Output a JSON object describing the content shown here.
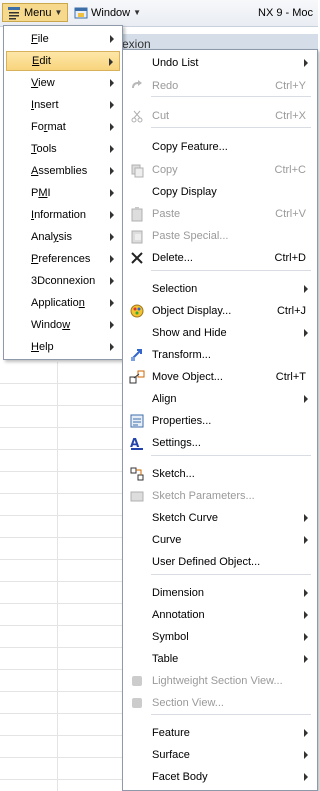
{
  "toolbar": {
    "menu_label": "Menu",
    "window_label": "Window",
    "app_title": "NX 9 - Moc"
  },
  "workspace": {
    "header_text": "exion"
  },
  "main_menu": {
    "items": [
      {
        "label": "File",
        "key": "F",
        "rest": "ile"
      },
      {
        "label": "Edit",
        "key": "E",
        "rest": "dit"
      },
      {
        "label": "View",
        "key": "V",
        "rest": "iew"
      },
      {
        "label": "Insert",
        "key": "I",
        "rest": "nsert"
      },
      {
        "label": "Format",
        "pre": "Fo",
        "key": "r",
        "rest": "mat"
      },
      {
        "label": "Tools",
        "key": "T",
        "rest": "ools"
      },
      {
        "label": "Assemblies",
        "key": "A",
        "rest": "ssemblies"
      },
      {
        "label": "PMI",
        "pre": "P",
        "key": "M",
        "rest": "I"
      },
      {
        "label": "Information",
        "key": "I",
        "rest": "nformation"
      },
      {
        "label": "Analysis",
        "pre": "Anal",
        "key": "y",
        "rest": "sis"
      },
      {
        "label": "Preferences",
        "key": "P",
        "rest": "references"
      },
      {
        "label": "3Dconnexion",
        "key": "",
        "rest": "3Dconnexion"
      },
      {
        "label": "Application",
        "pre": "Applicatio",
        "key": "n",
        "rest": ""
      },
      {
        "label": "Window",
        "pre": "Windo",
        "key": "w",
        "rest": ""
      },
      {
        "label": "Help",
        "key": "H",
        "rest": "elp"
      }
    ]
  },
  "edit_menu": {
    "items": [
      {
        "label": "Undo List",
        "shortcut": "",
        "submenu": true,
        "disabled": false
      },
      {
        "label": "Redo",
        "shortcut": "Ctrl+Y",
        "submenu": false,
        "disabled": true
      },
      {
        "label": "Cut",
        "shortcut": "Ctrl+X",
        "submenu": false,
        "disabled": true
      },
      {
        "label": "Copy Feature...",
        "shortcut": "",
        "submenu": false,
        "disabled": false
      },
      {
        "label": "Copy",
        "shortcut": "Ctrl+C",
        "submenu": false,
        "disabled": true
      },
      {
        "label": "Copy Display",
        "shortcut": "",
        "submenu": false,
        "disabled": false
      },
      {
        "label": "Paste",
        "shortcut": "Ctrl+V",
        "submenu": false,
        "disabled": true
      },
      {
        "label": "Paste Special...",
        "shortcut": "",
        "submenu": false,
        "disabled": true
      },
      {
        "label": "Delete...",
        "shortcut": "Ctrl+D",
        "submenu": false,
        "disabled": false
      },
      {
        "label": "Selection",
        "shortcut": "",
        "submenu": true,
        "disabled": false
      },
      {
        "label": "Object Display...",
        "shortcut": "Ctrl+J",
        "submenu": false,
        "disabled": false
      },
      {
        "label": "Show and Hide",
        "shortcut": "",
        "submenu": true,
        "disabled": false
      },
      {
        "label": "Transform...",
        "shortcut": "",
        "submenu": false,
        "disabled": false
      },
      {
        "label": "Move Object...",
        "shortcut": "Ctrl+T",
        "submenu": false,
        "disabled": false
      },
      {
        "label": "Align",
        "shortcut": "",
        "submenu": true,
        "disabled": false
      },
      {
        "label": "Properties...",
        "shortcut": "",
        "submenu": false,
        "disabled": false
      },
      {
        "label": "Settings...",
        "shortcut": "",
        "submenu": false,
        "disabled": false
      },
      {
        "label": "Sketch...",
        "shortcut": "",
        "submenu": false,
        "disabled": false
      },
      {
        "label": "Sketch Parameters...",
        "shortcut": "",
        "submenu": false,
        "disabled": true
      },
      {
        "label": "Sketch Curve",
        "shortcut": "",
        "submenu": true,
        "disabled": false
      },
      {
        "label": "Curve",
        "shortcut": "",
        "submenu": true,
        "disabled": false
      },
      {
        "label": "User Defined Object...",
        "shortcut": "",
        "submenu": false,
        "disabled": false
      },
      {
        "label": "Dimension",
        "shortcut": "",
        "submenu": true,
        "disabled": false
      },
      {
        "label": "Annotation",
        "shortcut": "",
        "submenu": true,
        "disabled": false
      },
      {
        "label": "Symbol",
        "shortcut": "",
        "submenu": true,
        "disabled": false
      },
      {
        "label": "Table",
        "shortcut": "",
        "submenu": true,
        "disabled": false
      },
      {
        "label": "Lightweight Section View...",
        "shortcut": "",
        "submenu": false,
        "disabled": true
      },
      {
        "label": "Section View...",
        "shortcut": "",
        "submenu": false,
        "disabled": true
      },
      {
        "label": "Feature",
        "shortcut": "",
        "submenu": true,
        "disabled": false
      },
      {
        "label": "Surface",
        "shortcut": "",
        "submenu": true,
        "disabled": false
      },
      {
        "label": "Facet Body",
        "shortcut": "",
        "submenu": true,
        "disabled": false
      }
    ]
  }
}
